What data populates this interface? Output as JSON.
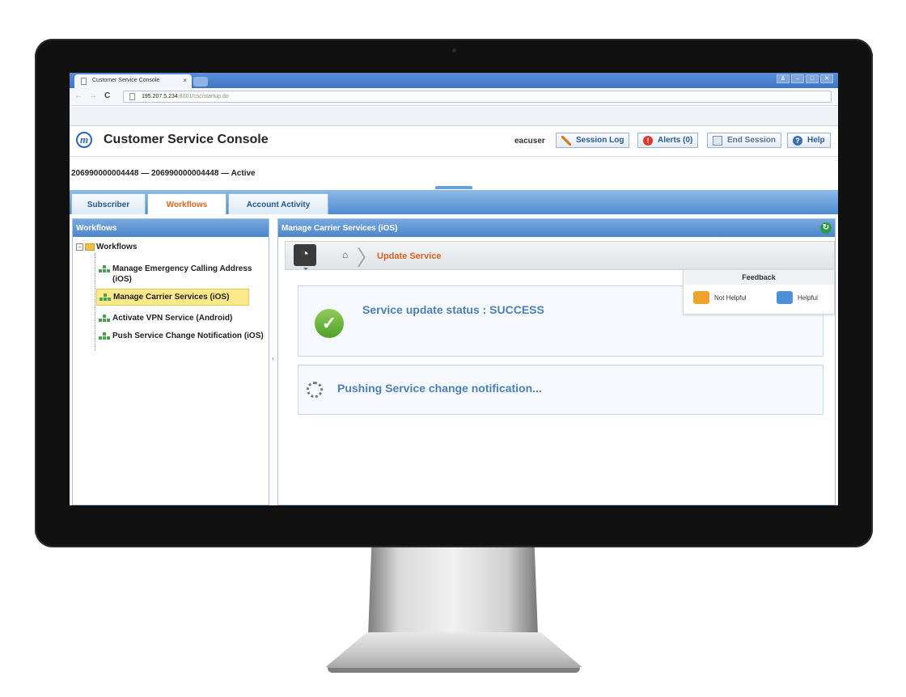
{
  "browser": {
    "tab_title": "Customer Service Console",
    "tab_close": "×",
    "url_host": "195.207.5.234",
    "url_path": ":8001/csc/startup.do",
    "window_controls": [
      "&",
      "–",
      "□",
      "✕"
    ]
  },
  "header": {
    "app_title": "Customer Service Console",
    "logo_letter": "m",
    "username": "eacuser",
    "buttons": {
      "session_log": "Session Log",
      "alerts": "Alerts (0)",
      "end_session": "End Session",
      "help": "Help"
    }
  },
  "subscriber": {
    "info": "206990000004448 — 206990000004448 — Active"
  },
  "tabs": [
    {
      "label": "Subscriber"
    },
    {
      "label": "Workflows"
    },
    {
      "label": "Account Activity"
    }
  ],
  "left_panel": {
    "title": "Workflows",
    "root_label": "Workflows",
    "items": [
      {
        "label": "Manage Emergency Calling Address (iOS)"
      },
      {
        "label": "Manage Carrier Services (iOS)"
      },
      {
        "label": "Activate VPN Service (Android)"
      },
      {
        "label": "Push Service Change Notification (iOS)"
      }
    ]
  },
  "right_panel": {
    "title": "Manage Carrier Services (iOS)",
    "breadcrumb": "Update Service",
    "status_text": "Service update status : SUCCESS",
    "progress_text": "Pushing Service change notification...",
    "feedback": {
      "title": "Feedback",
      "not_helpful": "Not Helpful",
      "helpful": "Helpful"
    }
  },
  "colors": {
    "accent_blue": "#4c85c9",
    "active_tab_orange": "#e0661c",
    "selected_highlight": "#fbe98c",
    "success_green": "#4fa02a"
  }
}
